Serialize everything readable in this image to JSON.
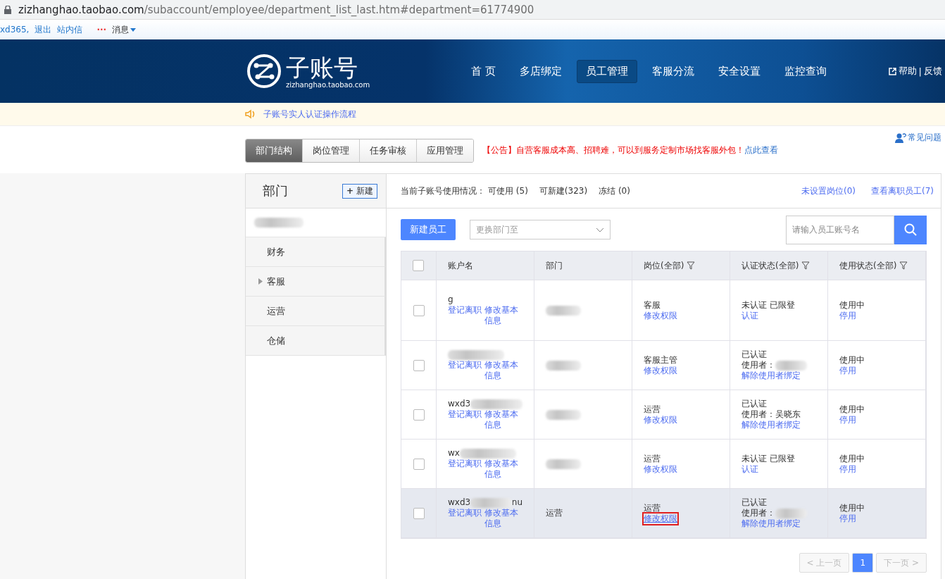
{
  "browser": {
    "url_host": "zizhanghao.taobao.com",
    "url_path": "/subaccount/employee/department_list_last.htm#department=61774900"
  },
  "top_links": {
    "user": "xd365,",
    "logout": "退出",
    "inbox": "站内信",
    "dots": "···",
    "messages": "消息"
  },
  "header": {
    "logo_title": "子账号",
    "logo_subtitle": "zizhanghao.taobao.com",
    "nav": [
      {
        "label": "首 页",
        "selected": false
      },
      {
        "label": "多店绑定",
        "selected": false
      },
      {
        "label": "员工管理",
        "selected": true
      },
      {
        "label": "客服分流",
        "selected": false
      },
      {
        "label": "安全设置",
        "selected": false
      },
      {
        "label": "监控查询",
        "selected": false
      }
    ],
    "help": "帮助",
    "separator": "|",
    "feedback": "反馈"
  },
  "notice": "子账号实人认证操作流程",
  "tabs": [
    {
      "label": "部门结构",
      "selected": true
    },
    {
      "label": "岗位管理",
      "selected": false
    },
    {
      "label": "任务审核",
      "selected": false
    },
    {
      "label": "应用管理",
      "selected": false
    }
  ],
  "announcement": {
    "tag": "【公告】",
    "text": "自营客服成本高、招聘难，可以到服务定制市场找客服外包！",
    "link": "点此查看"
  },
  "faq": "常见问题",
  "departments": {
    "title": "部门",
    "new_icon": "+",
    "new_button": "新建",
    "items": [
      {
        "label": "财务",
        "has_children": false
      },
      {
        "label": "客服",
        "expanded": false,
        "has_children": true
      },
      {
        "label": "运营",
        "has_children": false
      },
      {
        "label": "仓储",
        "has_children": false
      }
    ]
  },
  "usage": {
    "label": "当前子账号使用情况：",
    "available": "可使用 (5)",
    "creatable": "可新建(323)",
    "frozen": "冻结 (0)",
    "unassigned": "未设置岗位(0)",
    "resigned": "查看离职员工(7)"
  },
  "toolbar": {
    "new_employee": "新建员工",
    "move_placeholder": "更换部门至",
    "search_placeholder": "请输入员工账号名"
  },
  "table": {
    "select_all_checked": false,
    "columns": [
      {
        "label": "账户名",
        "filter": false
      },
      {
        "label": "部门",
        "filter": false
      },
      {
        "label": "岗位(全部)",
        "filter": true
      },
      {
        "label": "认证状态(全部)",
        "filter": true
      },
      {
        "label": "使用状态(全部)",
        "filter": true
      }
    ],
    "rows": [
      {
        "checked": false,
        "hovered": false,
        "account_prefix": "",
        "account_suffix": "g",
        "resign": "登记离职",
        "edit": "修改基本信息",
        "department": "",
        "role": "客服",
        "perm": "修改权限",
        "perm_highlighted": false,
        "auth_status": "未认证 已限登",
        "auth_user": "",
        "auth_action": "认证",
        "status": "使用中",
        "status_action": "停用"
      },
      {
        "checked": false,
        "hovered": false,
        "account_prefix": "",
        "account_suffix": "",
        "resign": "登记离职",
        "edit": "修改基本信息",
        "department": "",
        "role": "客服主管",
        "perm": "修改权限",
        "perm_highlighted": false,
        "auth_status": "已认证",
        "auth_user": "使用者：",
        "auth_action": "解除使用者绑定",
        "status": "使用中",
        "status_action": "停用"
      },
      {
        "checked": false,
        "hovered": false,
        "account_prefix": "wxd3",
        "account_suffix": "",
        "resign": "登记离职",
        "edit": "修改基本信息",
        "department": "",
        "role": "运营",
        "perm": "修改权限",
        "perm_highlighted": false,
        "auth_status": "已认证",
        "auth_user": "使用者：吴晓东",
        "auth_action": "解除使用者绑定",
        "status": "使用中",
        "status_action": "停用"
      },
      {
        "checked": false,
        "hovered": false,
        "account_prefix": "wx",
        "account_suffix": "",
        "resign": "登记离职",
        "edit": "修改基本信息",
        "department": "",
        "role": "运营",
        "perm": "修改权限",
        "perm_highlighted": false,
        "auth_status": "未认证 已限登",
        "auth_user": "",
        "auth_action": "认证",
        "status": "使用中",
        "status_action": "停用"
      },
      {
        "checked": false,
        "hovered": true,
        "account_prefix": "wxd3",
        "account_suffix": "nu",
        "resign": "登记离职",
        "edit": "修改基本信息",
        "department": "运营",
        "perm": "修改权限",
        "role": "运营",
        "perm_highlighted": true,
        "auth_status": "已认证",
        "auth_user": "使用者：",
        "auth_action": "解除使用者绑定",
        "status": "使用中",
        "status_action": "停用"
      }
    ]
  },
  "pagination": {
    "prev_icon": "<",
    "prev": "上一页",
    "pages": [
      {
        "label": "1",
        "selected": true
      }
    ],
    "next": "下一页",
    "next_icon": ">"
  }
}
